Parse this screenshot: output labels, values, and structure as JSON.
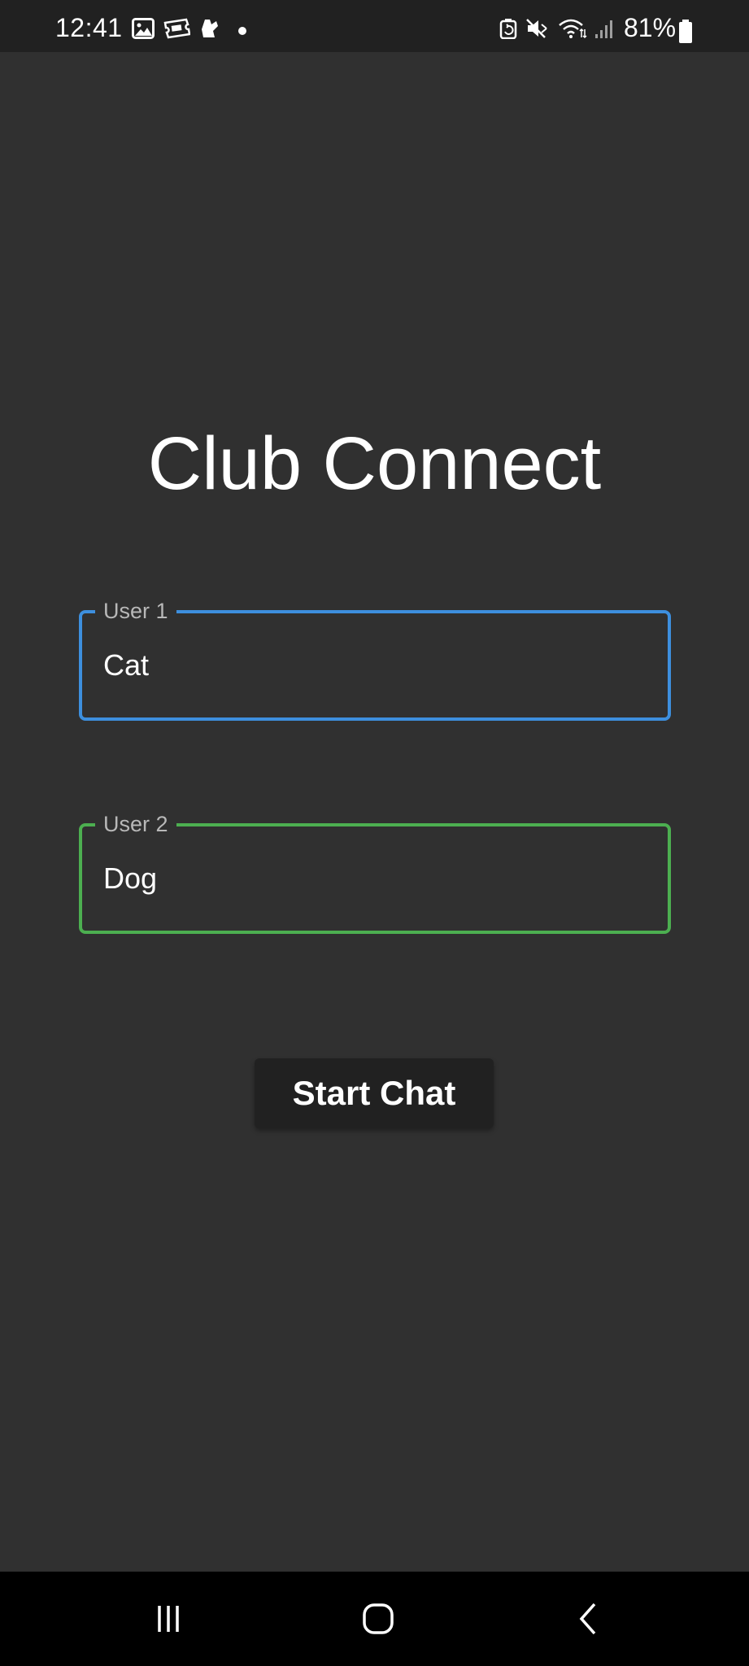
{
  "status_bar": {
    "time": "12:41",
    "battery_text": "81%",
    "notification_icons": [
      "gallery-icon",
      "ticket-icon",
      "delivery-icon",
      "dot-icon"
    ],
    "system_icons": [
      "battery-saver-icon",
      "mute-icon",
      "wifi-icon",
      "signal-icon",
      "battery-icon"
    ]
  },
  "app": {
    "title": "Club Connect"
  },
  "form": {
    "user1": {
      "label": "User 1",
      "value": "Cat",
      "border_color": "#3d8fde"
    },
    "user2": {
      "label": "User 2",
      "value": "Dog",
      "border_color": "#4caf50"
    },
    "start_button_label": "Start Chat"
  },
  "nav_bar": {
    "buttons": [
      "recent-apps-icon",
      "home-icon",
      "back-icon"
    ]
  },
  "colors": {
    "background": "#303030",
    "status_bar": "#212121",
    "nav_bar": "#000000",
    "button": "#212121"
  }
}
